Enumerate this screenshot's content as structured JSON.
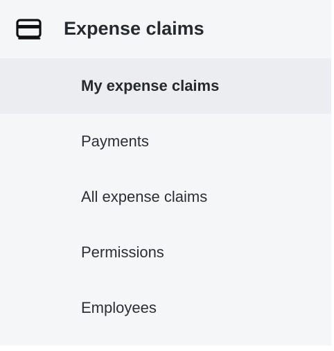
{
  "section": {
    "title": "Expense claims",
    "icon": "credit-card-icon"
  },
  "nav": {
    "items": [
      {
        "label": "My expense claims",
        "active": true
      },
      {
        "label": "Payments",
        "active": false
      },
      {
        "label": "All expense claims",
        "active": false
      },
      {
        "label": "Permissions",
        "active": false
      },
      {
        "label": "Employees",
        "active": false
      }
    ]
  },
  "colors": {
    "panel_background": "#f5f6f8",
    "active_background": "#ecedf0",
    "text": "#2b2f33"
  }
}
